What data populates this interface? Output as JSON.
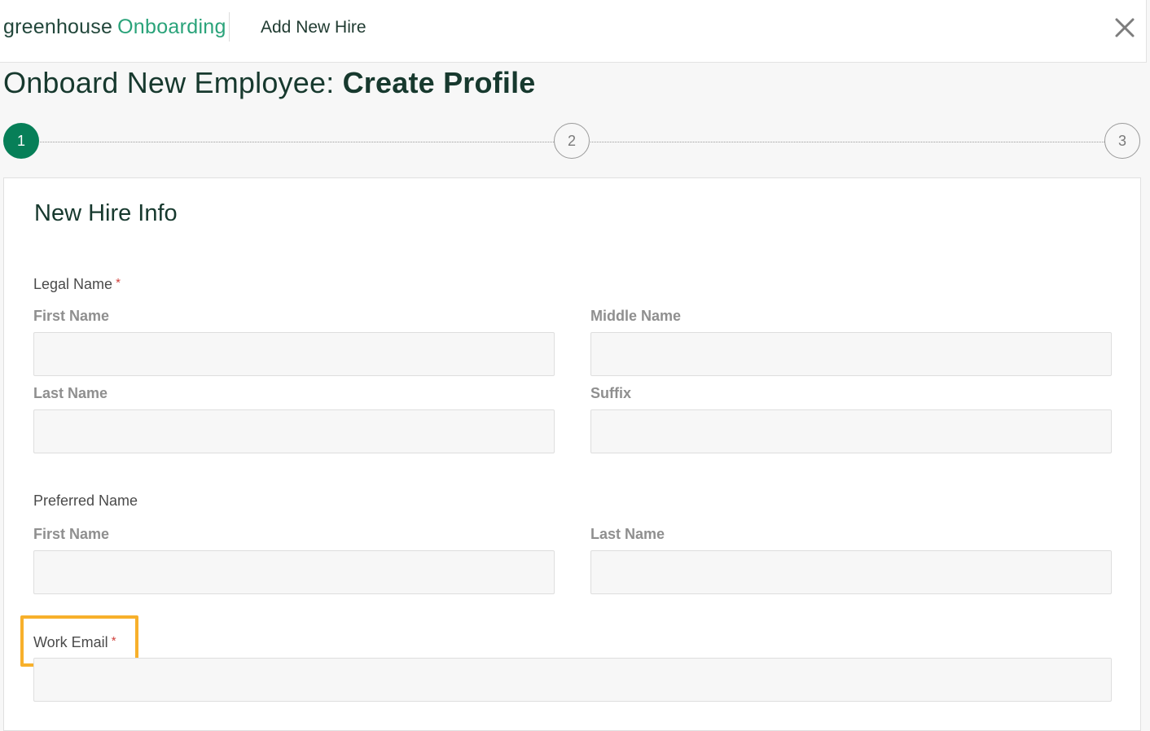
{
  "header": {
    "brand": "greenhouse",
    "product": "Onboarding",
    "title": "Add New Hire",
    "close_icon": "close-icon"
  },
  "page": {
    "title_prefix": "Onboard New Employee: ",
    "title_bold": "Create Profile"
  },
  "stepper": {
    "steps": [
      {
        "label": "1",
        "state": "active"
      },
      {
        "label": "2",
        "state": "inactive"
      },
      {
        "label": "3",
        "state": "inactive"
      }
    ],
    "active_color": "#077f58"
  },
  "form": {
    "section_title": "New Hire Info",
    "legal_name": {
      "label": "Legal Name",
      "required_mark": "*",
      "first_name_label": "First Name",
      "first_name_value": "",
      "middle_name_label": "Middle Name",
      "middle_name_value": "",
      "last_name_label": "Last Name",
      "last_name_value": "",
      "suffix_label": "Suffix",
      "suffix_value": ""
    },
    "preferred_name": {
      "label": "Preferred Name",
      "first_name_label": "First Name",
      "first_name_value": "",
      "last_name_label": "Last Name",
      "last_name_value": ""
    },
    "work_email": {
      "label": "Work Email",
      "required_mark": "*",
      "value": ""
    }
  },
  "colors": {
    "brand_dark": "#22473b",
    "brand_green": "#2aa37a",
    "required": "#d0413c",
    "highlight": "#f7b02b"
  }
}
